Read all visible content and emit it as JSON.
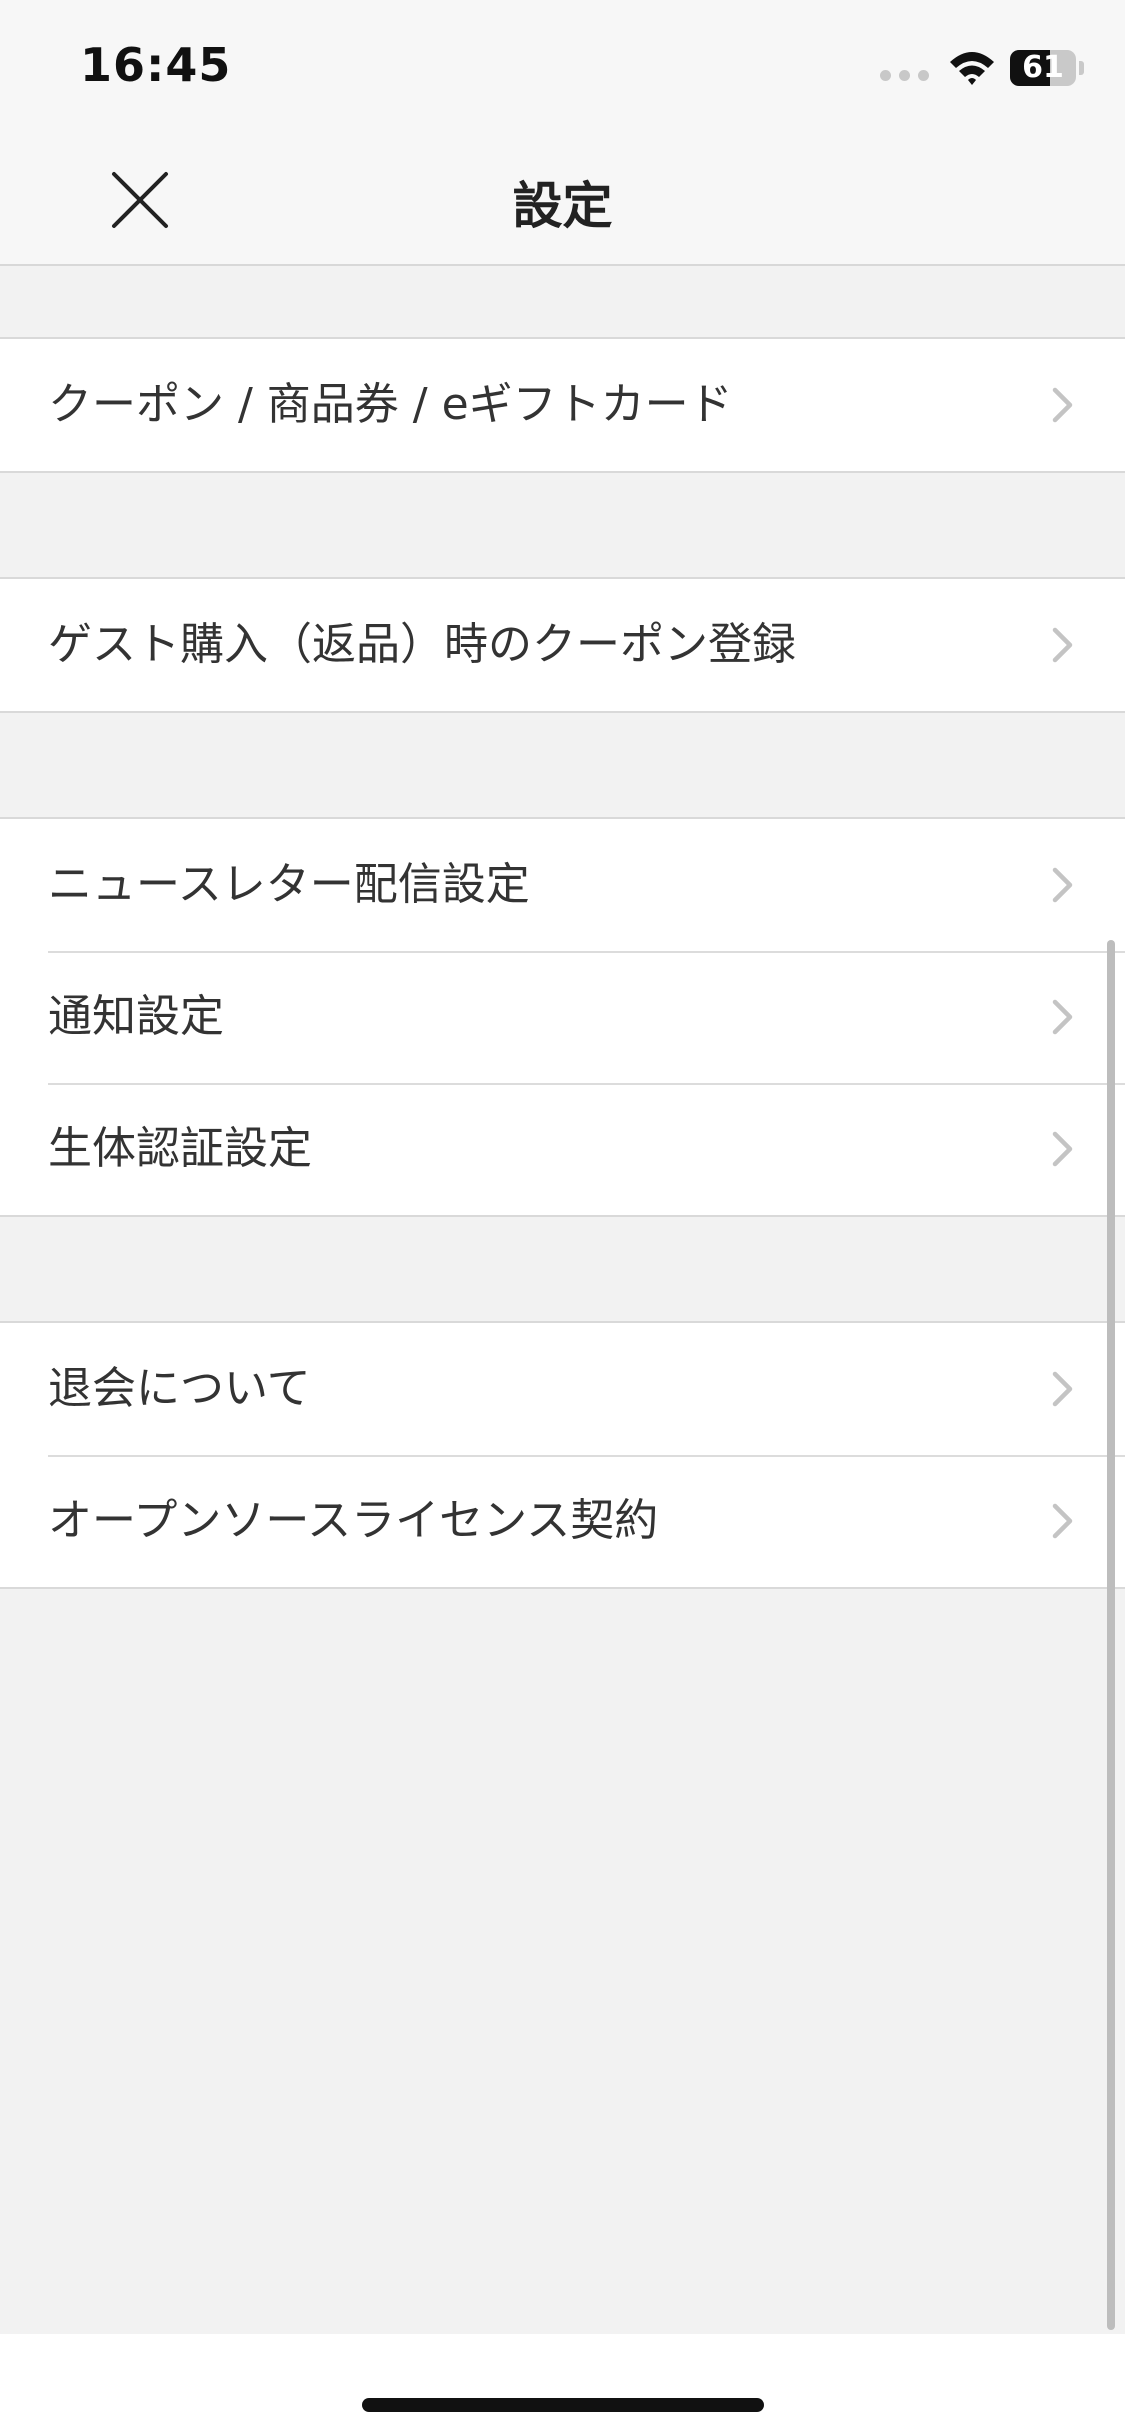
{
  "status_bar": {
    "time": "16:45",
    "battery_level": "61",
    "battery_fraction": 0.61
  },
  "nav": {
    "title": "設定",
    "close_icon": "close-icon"
  },
  "groups": [
    {
      "items": [
        {
          "label": "クーポン / 商品券 / eギフトカード"
        }
      ]
    },
    {
      "items": [
        {
          "label": "ゲスト購入（返品）時のクーポン登録"
        }
      ]
    },
    {
      "items": [
        {
          "label": "ニュースレター配信設定"
        },
        {
          "label": "通知設定"
        },
        {
          "label": "生体認証設定"
        }
      ]
    },
    {
      "items": [
        {
          "label": "退会について"
        },
        {
          "label": "オープンソースライセンス契約"
        }
      ]
    }
  ],
  "colors": {
    "background": "#f2f2f2",
    "row_background": "#ffffff",
    "chevron": "#c4c4c4",
    "text": "#333333"
  }
}
